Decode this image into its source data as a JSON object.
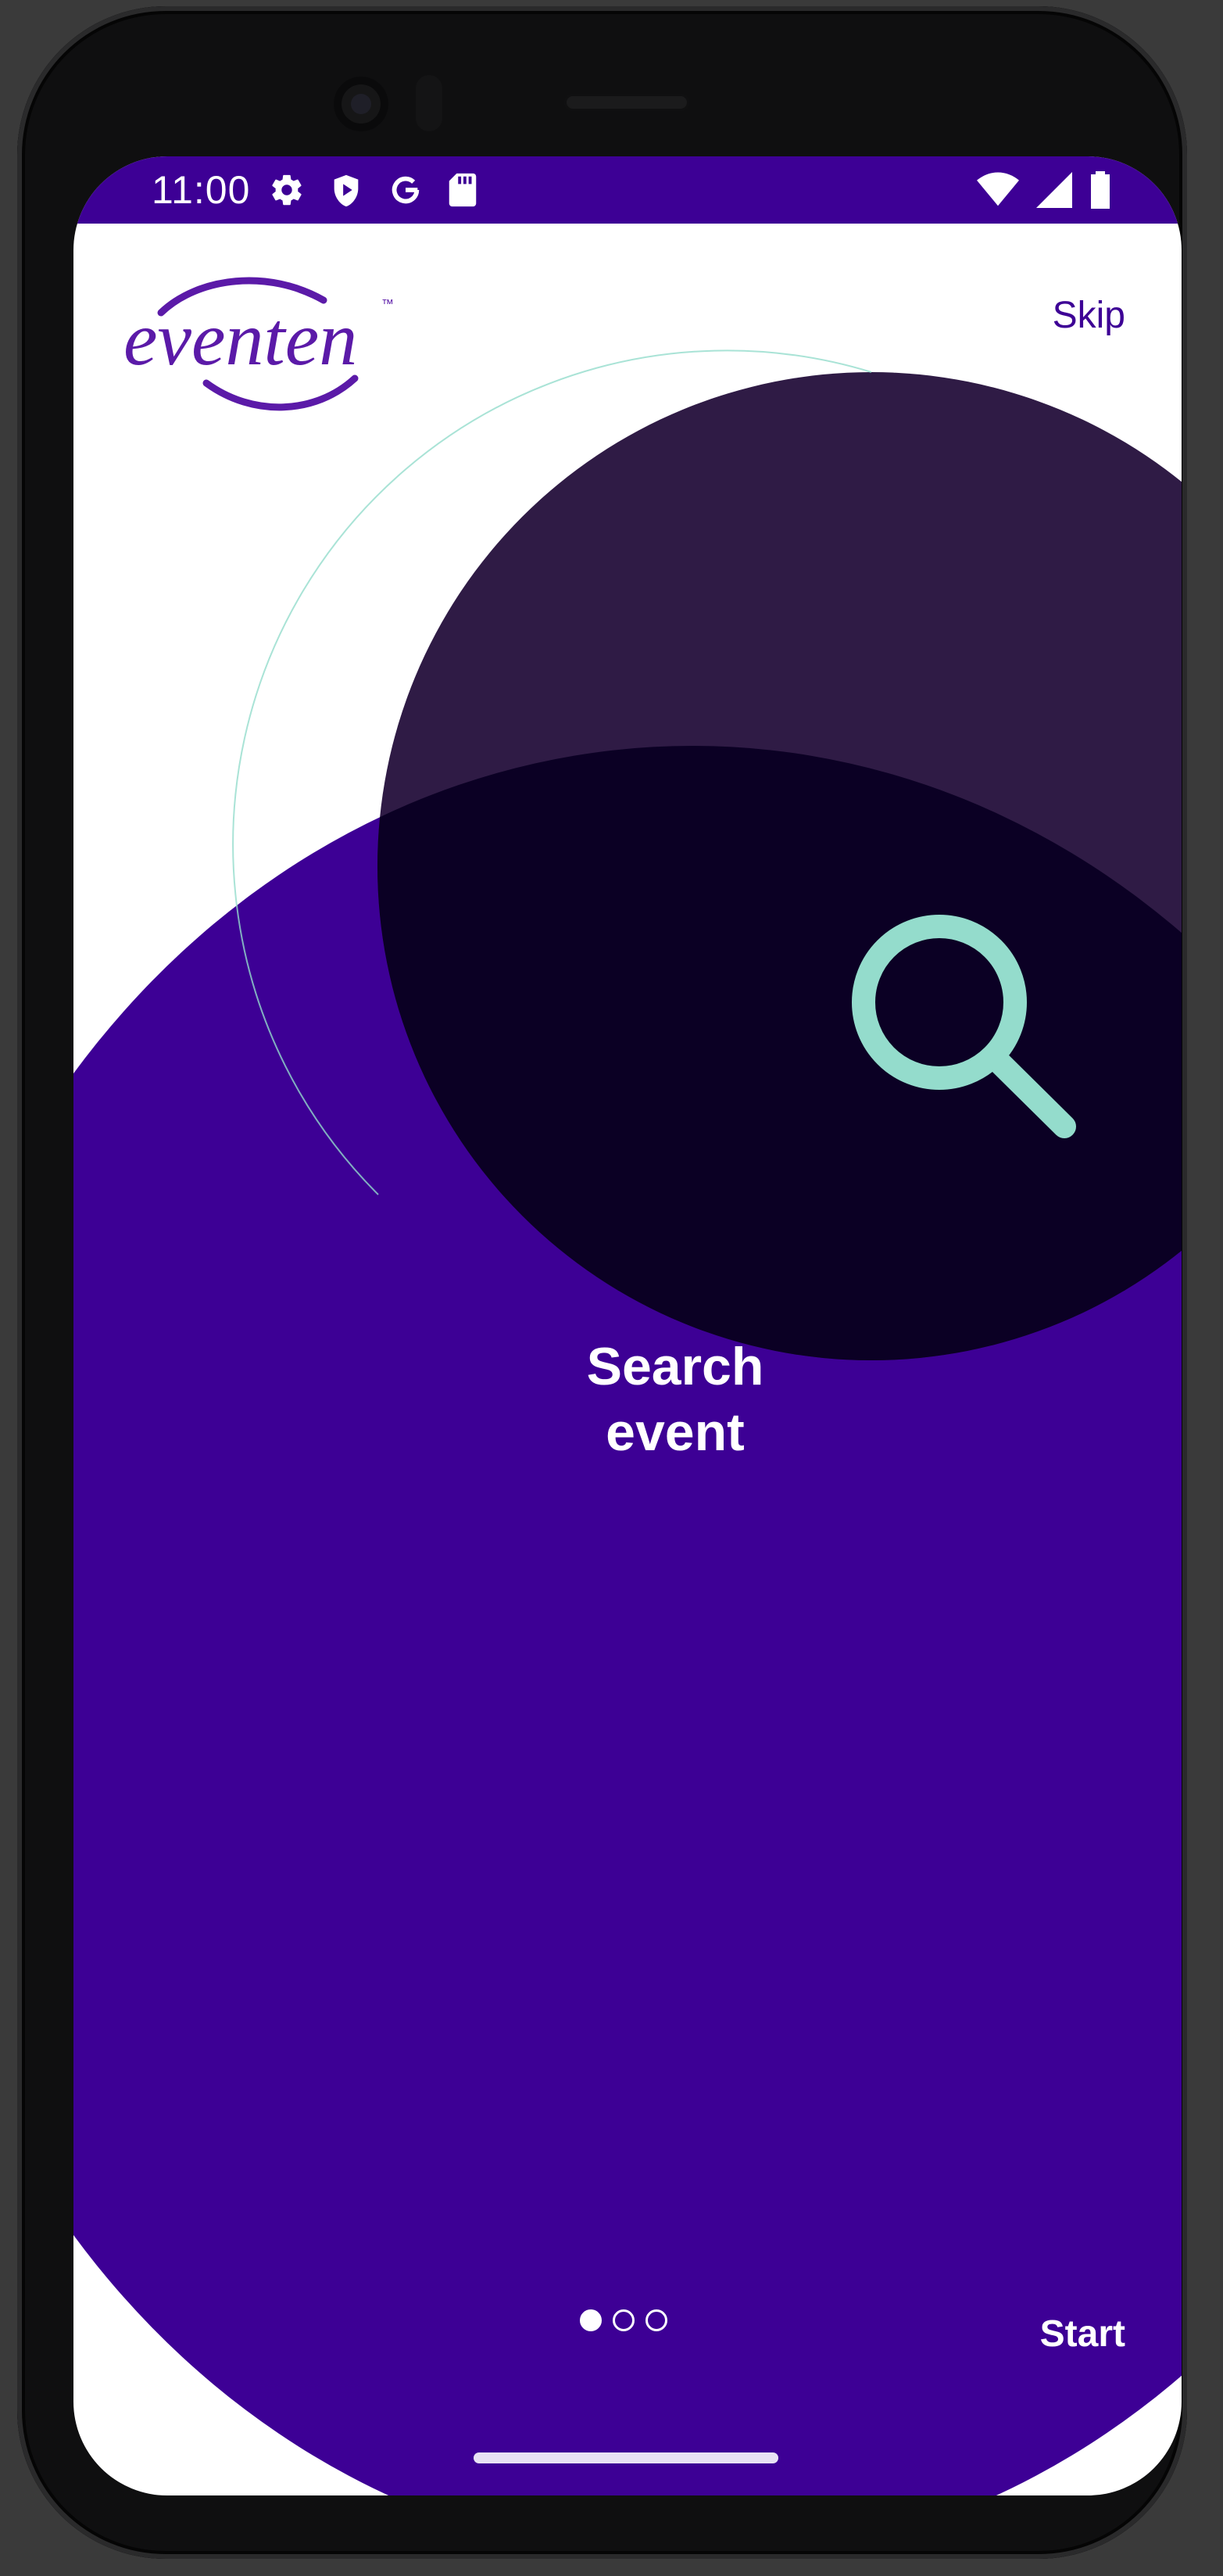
{
  "status_bar": {
    "time": "11:00",
    "left_icons": [
      "settings-icon",
      "play-protect-icon",
      "google-icon",
      "sd-card-icon"
    ],
    "right_icons": [
      "wifi-icon",
      "cellular-signal-icon",
      "battery-icon"
    ]
  },
  "header": {
    "logo_text": "eventen",
    "logo_mark": "™",
    "skip_label": "Skip"
  },
  "slide": {
    "title": "Search\nevent",
    "title_line1": "Search",
    "title_line2": "event",
    "illustration_icon": "search-icon"
  },
  "footer": {
    "pages": 3,
    "current_page": 1,
    "start_label": "Start"
  },
  "colors": {
    "brand": "#3d0095",
    "logo": "#5b1aa8",
    "dark_circle": "#2f1b45",
    "overlap": "#0b0024",
    "accent": "#94dccc",
    "background": "#ffffff"
  }
}
